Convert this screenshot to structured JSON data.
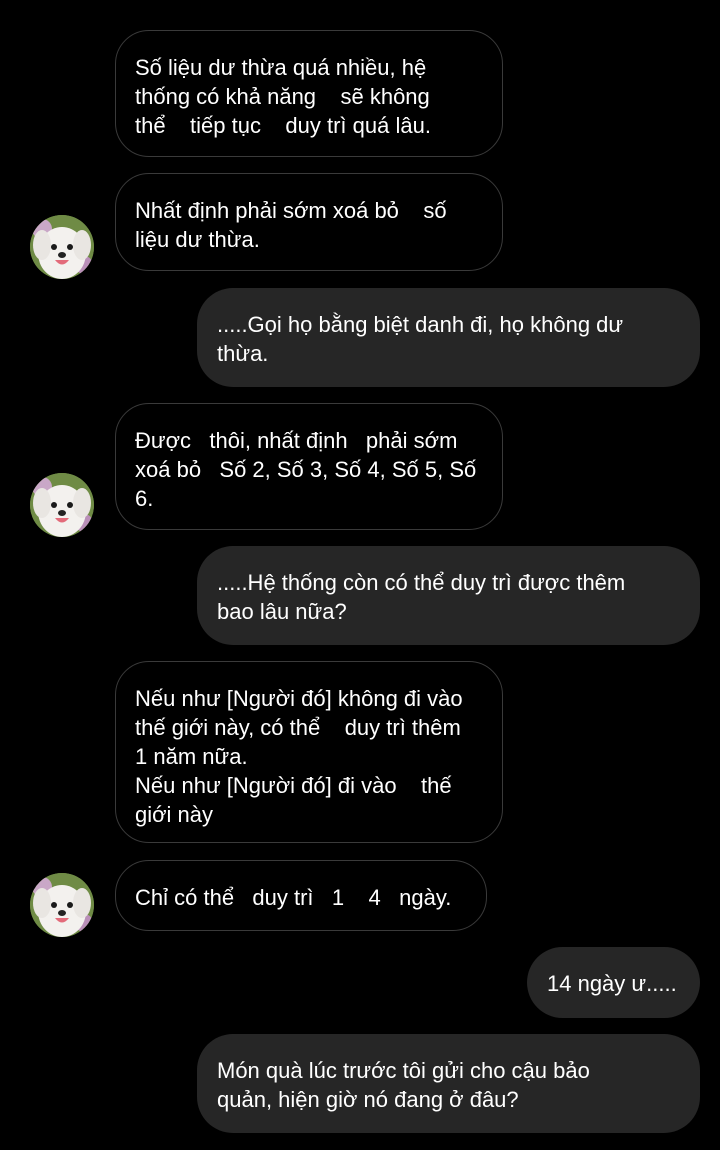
{
  "messages": [
    {
      "side": "received",
      "text": "Số liệu dư thừa quá nhiều, hệ\nthống có khả năng    sẽ không\nthể    tiếp tục    duy trì quá lâu."
    },
    {
      "side": "received",
      "text": "Nhất định phải sớm xoá bỏ    số\nliệu dư thừa."
    },
    {
      "side": "sent",
      "text": ".....Gọi họ bằng biệt danh đi, họ không dư\nthừa."
    },
    {
      "side": "received",
      "text": "Được   thôi, nhất định   phải sớm\nxoá bỏ   Số 2, Số 3, Số 4, Số 5, Số\n6."
    },
    {
      "side": "sent",
      "text": ".....Hệ thống còn có thể duy trì được thêm\nbao lâu nữa?"
    },
    {
      "side": "received",
      "text": "Nếu như [Người đó] không đi vào\nthế giới này, có thể    duy trì thêm\n1 năm nữa.\nNếu như [Người đó] đi vào    thế\ngiới này"
    },
    {
      "side": "received",
      "text": "Chỉ có thể   duy trì   1    4   ngày."
    },
    {
      "side": "sent",
      "text": "14 ngày ư....."
    },
    {
      "side": "sent",
      "text": "Món quà lúc trước tôi gửi cho cậu bảo\nquản, hiện giờ nó đang ở đâu?"
    }
  ],
  "avatar": {
    "icon": "dog-avatar-icon"
  },
  "colors": {
    "background": "#000000",
    "sent_bubble": "#262626",
    "received_border": "#3a3a3a",
    "text": "#ffffff"
  }
}
